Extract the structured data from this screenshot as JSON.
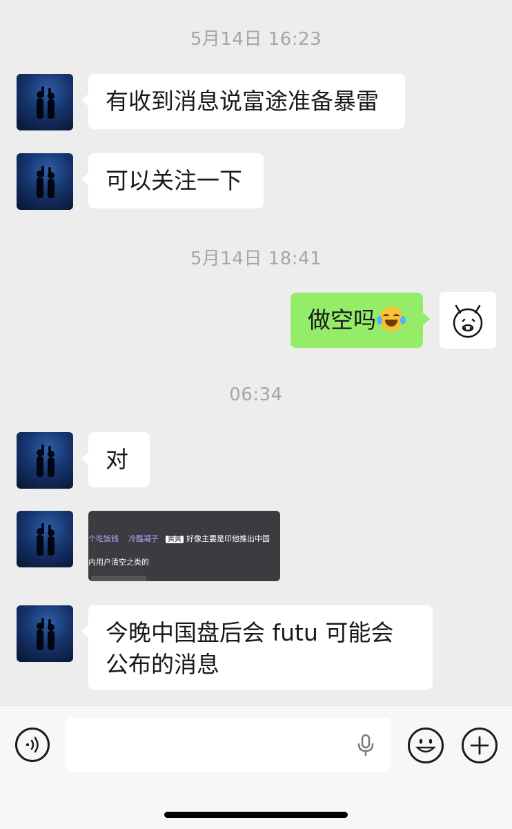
{
  "chat": {
    "timestamps": [
      "5月14日 16:23",
      "5月14日 18:41",
      "06:34"
    ],
    "messages": [
      {
        "side": "left",
        "text": "有收到消息说富途准备暴雷"
      },
      {
        "side": "left",
        "text": "可以关注一下"
      },
      {
        "side": "right",
        "text": "做空吗",
        "emoji": "tears-of-joy-emoji"
      },
      {
        "side": "left",
        "text": "对"
      },
      {
        "side": "left",
        "type": "image",
        "image_text": {
          "user1": "个吃饭钱",
          "user2": "冷酷凝子",
          "tag": "黄黄",
          "line1_text": "好像主要是印他推出中国",
          "line2_text": "内用户清空之类的"
        }
      },
      {
        "side": "left",
        "text": "今晚中国盘后会 futu 可能会公布的消息"
      }
    ]
  },
  "input_bar": {
    "icons": [
      "voice-icon",
      "mic-icon",
      "emoji-icon",
      "add-icon"
    ],
    "value": "",
    "placeholder": ""
  },
  "colors": {
    "background": "#ededed",
    "self_bubble": "#95ec69",
    "other_bubble": "#ffffff"
  }
}
